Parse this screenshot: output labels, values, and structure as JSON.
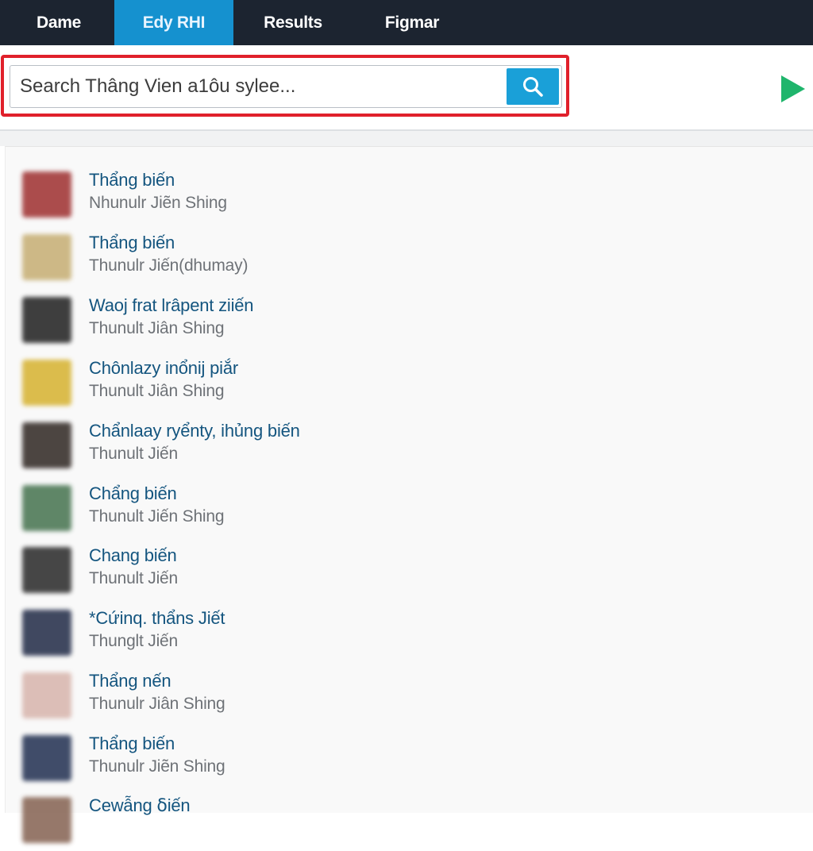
{
  "nav": {
    "tabs": [
      {
        "label": "Dame",
        "active": false
      },
      {
        "label": "Edy RHI",
        "active": true
      },
      {
        "label": "Results",
        "active": false
      },
      {
        "label": "Figmar",
        "active": false
      }
    ]
  },
  "search": {
    "placeholder": "Search Thâng Vien a1ôu sylee...",
    "value": "",
    "button_icon": "search-icon",
    "highlight_color": "#e0202b"
  },
  "actions": {
    "play_icon": "play-icon",
    "play_color": "#1fb56c"
  },
  "results": [
    {
      "title": "Thẩng biến",
      "subtitle": "Nhunulr Jiẽn Shing",
      "thumb_color": "#a33a3a"
    },
    {
      "title": "Thẩng biến",
      "subtitle": "Thunulr Jiến(dhumay)",
      "thumb_color": "#c9b27a"
    },
    {
      "title": "Waoj frat lrâpent ziiến",
      "subtitle": "Thunult Jiân Shing",
      "thumb_color": "#2a2a2a"
    },
    {
      "title": "Chônlazy inổnij piắr",
      "subtitle": "Thunult Jiân Shing",
      "thumb_color": "#d8b63a"
    },
    {
      "title": "Chẩnlaay ryểnty, ihủng biến",
      "subtitle": "Thunult Jiến",
      "thumb_color": "#3a322e"
    },
    {
      "title": "Chẩng biến",
      "subtitle": "Thunult Jiến Shing",
      "thumb_color": "#4f7a58"
    },
    {
      "title": "Chang biến",
      "subtitle": "Thunult Jiến",
      "thumb_color": "#333333"
    },
    {
      "title": "*Cứinq. thẩns Jiết",
      "subtitle": "Thunglt Jiến",
      "thumb_color": "#2c3550"
    },
    {
      "title": "Thẩng nến",
      "subtitle": "Thunulr Jiân Shing",
      "thumb_color": "#d9b8b0"
    },
    {
      "title": "Thẩng biến",
      "subtitle": "Thunulr Jiẽn Shing",
      "thumb_color": "#2d3a5a"
    },
    {
      "title": "Cewẫng ẟiến",
      "subtitle": "",
      "thumb_color": "#8b6a5a"
    }
  ]
}
